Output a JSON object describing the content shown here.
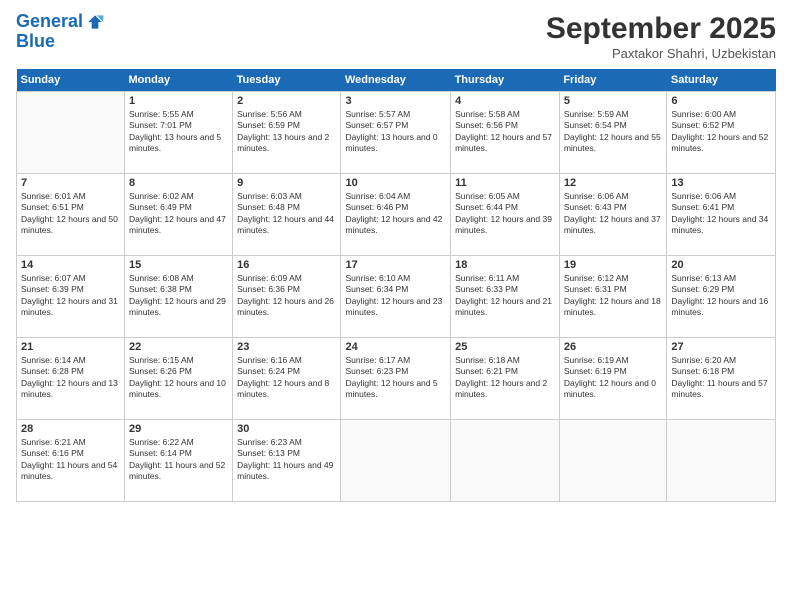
{
  "header": {
    "logo_line1": "General",
    "logo_line2": "Blue",
    "month": "September 2025",
    "location": "Paxtakor Shahri, Uzbekistan"
  },
  "days_of_week": [
    "Sunday",
    "Monday",
    "Tuesday",
    "Wednesday",
    "Thursday",
    "Friday",
    "Saturday"
  ],
  "weeks": [
    [
      {
        "num": "",
        "empty": true
      },
      {
        "num": "1",
        "sunrise": "Sunrise: 5:55 AM",
        "sunset": "Sunset: 7:01 PM",
        "daylight": "Daylight: 13 hours and 5 minutes."
      },
      {
        "num": "2",
        "sunrise": "Sunrise: 5:56 AM",
        "sunset": "Sunset: 6:59 PM",
        "daylight": "Daylight: 13 hours and 2 minutes."
      },
      {
        "num": "3",
        "sunrise": "Sunrise: 5:57 AM",
        "sunset": "Sunset: 6:57 PM",
        "daylight": "Daylight: 13 hours and 0 minutes."
      },
      {
        "num": "4",
        "sunrise": "Sunrise: 5:58 AM",
        "sunset": "Sunset: 6:56 PM",
        "daylight": "Daylight: 12 hours and 57 minutes."
      },
      {
        "num": "5",
        "sunrise": "Sunrise: 5:59 AM",
        "sunset": "Sunset: 6:54 PM",
        "daylight": "Daylight: 12 hours and 55 minutes."
      },
      {
        "num": "6",
        "sunrise": "Sunrise: 6:00 AM",
        "sunset": "Sunset: 6:52 PM",
        "daylight": "Daylight: 12 hours and 52 minutes."
      }
    ],
    [
      {
        "num": "7",
        "sunrise": "Sunrise: 6:01 AM",
        "sunset": "Sunset: 6:51 PM",
        "daylight": "Daylight: 12 hours and 50 minutes."
      },
      {
        "num": "8",
        "sunrise": "Sunrise: 6:02 AM",
        "sunset": "Sunset: 6:49 PM",
        "daylight": "Daylight: 12 hours and 47 minutes."
      },
      {
        "num": "9",
        "sunrise": "Sunrise: 6:03 AM",
        "sunset": "Sunset: 6:48 PM",
        "daylight": "Daylight: 12 hours and 44 minutes."
      },
      {
        "num": "10",
        "sunrise": "Sunrise: 6:04 AM",
        "sunset": "Sunset: 6:46 PM",
        "daylight": "Daylight: 12 hours and 42 minutes."
      },
      {
        "num": "11",
        "sunrise": "Sunrise: 6:05 AM",
        "sunset": "Sunset: 6:44 PM",
        "daylight": "Daylight: 12 hours and 39 minutes."
      },
      {
        "num": "12",
        "sunrise": "Sunrise: 6:06 AM",
        "sunset": "Sunset: 6:43 PM",
        "daylight": "Daylight: 12 hours and 37 minutes."
      },
      {
        "num": "13",
        "sunrise": "Sunrise: 6:06 AM",
        "sunset": "Sunset: 6:41 PM",
        "daylight": "Daylight: 12 hours and 34 minutes."
      }
    ],
    [
      {
        "num": "14",
        "sunrise": "Sunrise: 6:07 AM",
        "sunset": "Sunset: 6:39 PM",
        "daylight": "Daylight: 12 hours and 31 minutes."
      },
      {
        "num": "15",
        "sunrise": "Sunrise: 6:08 AM",
        "sunset": "Sunset: 6:38 PM",
        "daylight": "Daylight: 12 hours and 29 minutes."
      },
      {
        "num": "16",
        "sunrise": "Sunrise: 6:09 AM",
        "sunset": "Sunset: 6:36 PM",
        "daylight": "Daylight: 12 hours and 26 minutes."
      },
      {
        "num": "17",
        "sunrise": "Sunrise: 6:10 AM",
        "sunset": "Sunset: 6:34 PM",
        "daylight": "Daylight: 12 hours and 23 minutes."
      },
      {
        "num": "18",
        "sunrise": "Sunrise: 6:11 AM",
        "sunset": "Sunset: 6:33 PM",
        "daylight": "Daylight: 12 hours and 21 minutes."
      },
      {
        "num": "19",
        "sunrise": "Sunrise: 6:12 AM",
        "sunset": "Sunset: 6:31 PM",
        "daylight": "Daylight: 12 hours and 18 minutes."
      },
      {
        "num": "20",
        "sunrise": "Sunrise: 6:13 AM",
        "sunset": "Sunset: 6:29 PM",
        "daylight": "Daylight: 12 hours and 16 minutes."
      }
    ],
    [
      {
        "num": "21",
        "sunrise": "Sunrise: 6:14 AM",
        "sunset": "Sunset: 6:28 PM",
        "daylight": "Daylight: 12 hours and 13 minutes."
      },
      {
        "num": "22",
        "sunrise": "Sunrise: 6:15 AM",
        "sunset": "Sunset: 6:26 PM",
        "daylight": "Daylight: 12 hours and 10 minutes."
      },
      {
        "num": "23",
        "sunrise": "Sunrise: 6:16 AM",
        "sunset": "Sunset: 6:24 PM",
        "daylight": "Daylight: 12 hours and 8 minutes."
      },
      {
        "num": "24",
        "sunrise": "Sunrise: 6:17 AM",
        "sunset": "Sunset: 6:23 PM",
        "daylight": "Daylight: 12 hours and 5 minutes."
      },
      {
        "num": "25",
        "sunrise": "Sunrise: 6:18 AM",
        "sunset": "Sunset: 6:21 PM",
        "daylight": "Daylight: 12 hours and 2 minutes."
      },
      {
        "num": "26",
        "sunrise": "Sunrise: 6:19 AM",
        "sunset": "Sunset: 6:19 PM",
        "daylight": "Daylight: 12 hours and 0 minutes."
      },
      {
        "num": "27",
        "sunrise": "Sunrise: 6:20 AM",
        "sunset": "Sunset: 6:18 PM",
        "daylight": "Daylight: 11 hours and 57 minutes."
      }
    ],
    [
      {
        "num": "28",
        "sunrise": "Sunrise: 6:21 AM",
        "sunset": "Sunset: 6:16 PM",
        "daylight": "Daylight: 11 hours and 54 minutes."
      },
      {
        "num": "29",
        "sunrise": "Sunrise: 6:22 AM",
        "sunset": "Sunset: 6:14 PM",
        "daylight": "Daylight: 11 hours and 52 minutes."
      },
      {
        "num": "30",
        "sunrise": "Sunrise: 6:23 AM",
        "sunset": "Sunset: 6:13 PM",
        "daylight": "Daylight: 11 hours and 49 minutes."
      },
      {
        "num": "",
        "empty": true
      },
      {
        "num": "",
        "empty": true
      },
      {
        "num": "",
        "empty": true
      },
      {
        "num": "",
        "empty": true
      }
    ]
  ]
}
